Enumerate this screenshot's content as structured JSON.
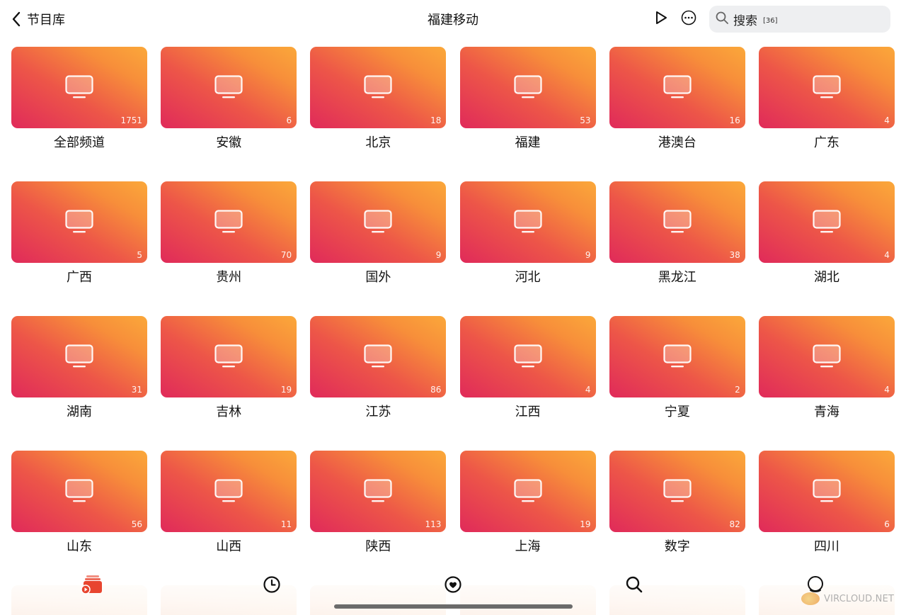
{
  "header": {
    "back_label": "节目库",
    "title": "福建移动",
    "search_label": "搜索",
    "search_count": "[36]"
  },
  "categories": [
    {
      "name": "全部频道",
      "count": "1751"
    },
    {
      "name": "安徽",
      "count": "6"
    },
    {
      "name": "北京",
      "count": "18"
    },
    {
      "name": "福建",
      "count": "53"
    },
    {
      "name": "港澳台",
      "count": "16"
    },
    {
      "name": "广东",
      "count": "4"
    },
    {
      "name": "广西",
      "count": "5"
    },
    {
      "name": "贵州",
      "count": "70"
    },
    {
      "name": "国外",
      "count": "9"
    },
    {
      "name": "河北",
      "count": "9"
    },
    {
      "name": "黑龙江",
      "count": "38"
    },
    {
      "name": "湖北",
      "count": "4"
    },
    {
      "name": "湖南",
      "count": "31"
    },
    {
      "name": "吉林",
      "count": "19"
    },
    {
      "name": "江苏",
      "count": "86"
    },
    {
      "name": "江西",
      "count": "4"
    },
    {
      "name": "宁夏",
      "count": "2"
    },
    {
      "name": "青海",
      "count": "4"
    },
    {
      "name": "山东",
      "count": "56"
    },
    {
      "name": "山西",
      "count": "11"
    },
    {
      "name": "陕西",
      "count": "113"
    },
    {
      "name": "上海",
      "count": "19"
    },
    {
      "name": "数字",
      "count": "82"
    },
    {
      "name": "四川",
      "count": "6"
    }
  ],
  "tabbar": {
    "tabs": [
      {
        "icon": "tv-library-icon",
        "active": true
      },
      {
        "icon": "history-clock-icon",
        "active": false
      },
      {
        "icon": "favorites-heart-icon",
        "active": false
      },
      {
        "icon": "search-icon",
        "active": false
      },
      {
        "icon": "profile-icon",
        "active": false
      }
    ]
  },
  "colors": {
    "accent": "#e8452f",
    "card_gradient_start": "#e02a5a",
    "card_gradient_end": "#fba83a"
  },
  "watermark": "VIRCLOUD.NET"
}
